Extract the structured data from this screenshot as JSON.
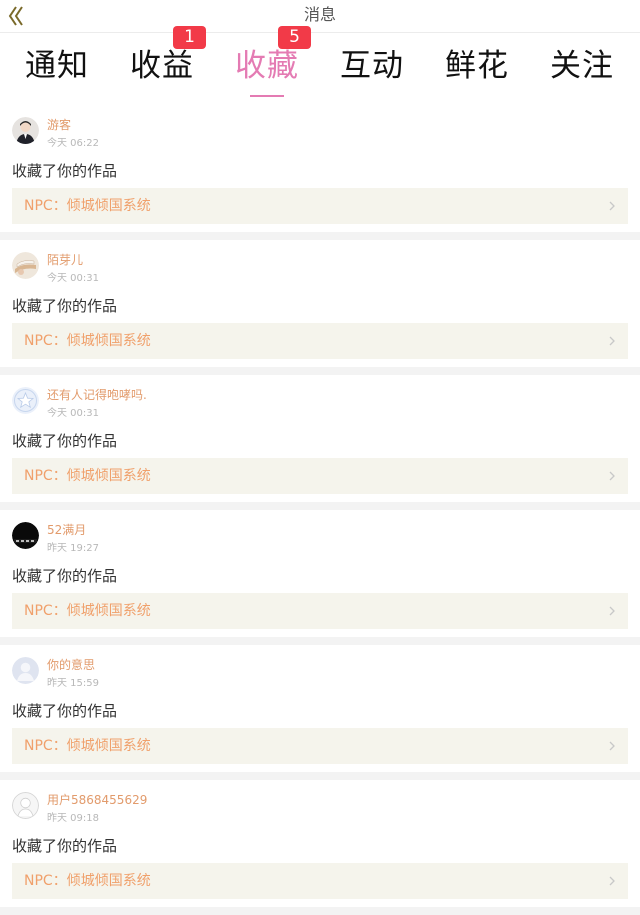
{
  "header": {
    "title": "消息"
  },
  "tabs": [
    {
      "label": "通知",
      "badge": ""
    },
    {
      "label": "收益",
      "badge": "1"
    },
    {
      "label": "收藏",
      "badge": "5",
      "active": true
    },
    {
      "label": "互动",
      "badge": ""
    },
    {
      "label": "鲜花",
      "badge": ""
    },
    {
      "label": "关注",
      "badge": ""
    }
  ],
  "messages": [
    {
      "username": "游客",
      "time": "今天 06:22",
      "action": "收藏了你的作品",
      "work": "NPC：倾城倾国系统",
      "avatar_icon": "person-avatar-icon"
    },
    {
      "username": "陌芽儿",
      "time": "今天 00:31",
      "action": "收藏了你的作品",
      "work": "NPC：倾城倾国系统",
      "avatar_icon": "book-avatar-icon"
    },
    {
      "username": "还有人记得咆哮吗.",
      "time": "今天 00:31",
      "action": "收藏了你的作品",
      "work": "NPC：倾城倾国系统",
      "avatar_icon": "star-avatar-icon"
    },
    {
      "username": "52满月",
      "time": "昨天 19:27",
      "action": "收藏了你的作品",
      "work": "NPC：倾城倾国系统",
      "avatar_icon": "dark-avatar-icon"
    },
    {
      "username": "你的意思",
      "time": "昨天 15:59",
      "action": "收藏了你的作品",
      "work": "NPC：倾城倾国系统",
      "avatar_icon": "default-avatar-icon"
    },
    {
      "username": "用户5868455629",
      "time": "昨天 09:18",
      "action": "收藏了你的作品",
      "work": "NPC：倾城倾国系统",
      "avatar_icon": "outline-avatar-icon"
    }
  ],
  "colors": {
    "accent_pink": "#e47bb3",
    "badge_red": "#f23a48",
    "username_orange": "#e29b6c",
    "work_orange": "#f0a06b",
    "work_bg": "#f5f4ec"
  }
}
